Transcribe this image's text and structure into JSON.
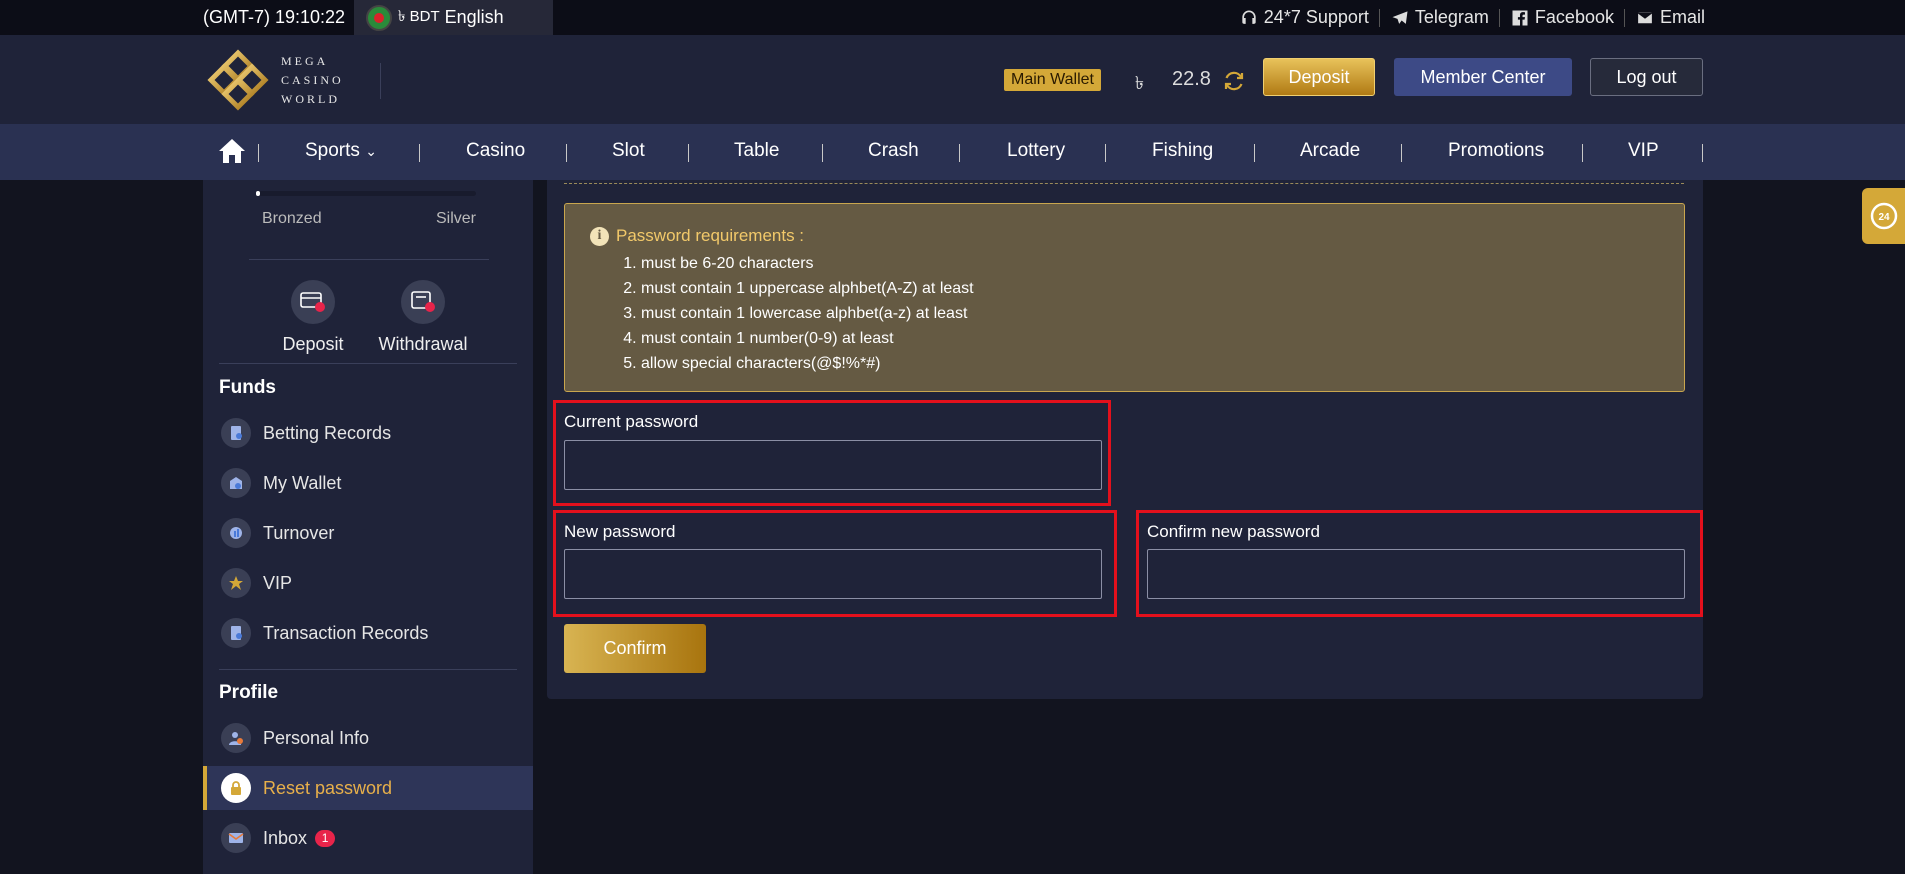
{
  "topbar": {
    "time": "(GMT-7) 19:10:22",
    "currency": "৳ BDT",
    "language": "English",
    "links": [
      "24*7 Support",
      "Telegram",
      "Facebook",
      "Email"
    ]
  },
  "header": {
    "logo_lines": [
      "MEGA",
      "CASINO",
      "WORLD"
    ],
    "wallet_label": "Main Wallet",
    "wallet_currency": "৳",
    "wallet_amount": "22.8",
    "deposit": "Deposit",
    "member_center": "Member Center",
    "logout": "Log out"
  },
  "nav": [
    "Sports",
    "Casino",
    "Slot",
    "Table",
    "Crash",
    "Lottery",
    "Fishing",
    "Arcade",
    "Promotions",
    "VIP"
  ],
  "sidebar": {
    "level_progress": 0.02,
    "level_from": "Bronzed",
    "level_to": "Silver",
    "quick": [
      "Deposit",
      "Withdrawal"
    ],
    "funds_heading": "Funds",
    "funds": [
      "Betting Records",
      "My Wallet",
      "Turnover",
      "VIP",
      "Transaction Records"
    ],
    "profile_heading": "Profile",
    "profile": [
      "Personal Info",
      "Reset password",
      "Inbox"
    ],
    "inbox_count": "1"
  },
  "reset": {
    "req_title": "Password requirements :",
    "requirements": [
      "must be 6-20 characters",
      "must contain 1 uppercase alphbet(A-Z) at least",
      "must contain 1 lowercase alphbet(a-z) at least",
      "must contain 1 number(0-9) at least",
      "allow special characters(@$!%*#)"
    ],
    "current_label": "Current password",
    "current_value": "",
    "new_label": "New password",
    "new_value": "",
    "confirm_label": "Confirm new password",
    "confirm_value": "",
    "confirm_button": "Confirm"
  },
  "float_badge": "24",
  "colors": {
    "accent": "#d4a838",
    "highlight": "#e3101c",
    "panel": "#1f2339"
  }
}
